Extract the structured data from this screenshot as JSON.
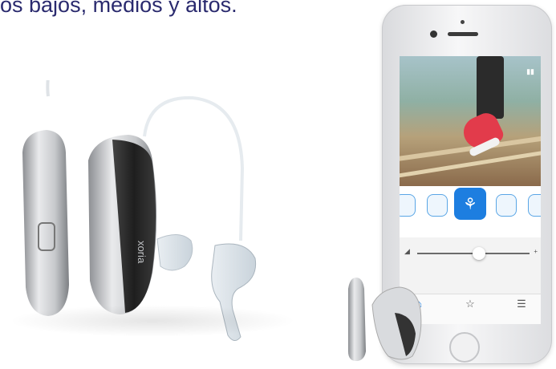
{
  "headline": "os bajos, medios y altos.",
  "hearing_aid": {
    "brand": "xoria"
  },
  "phone_app": {
    "colors": {
      "accent": "#1d7ee0",
      "shoe": "#e23b4b"
    },
    "programs": [
      {
        "icon": "programs-icon"
      },
      {
        "icon": "restaurant-icon"
      },
      {
        "icon": "sport-running-icon",
        "active": true
      },
      {
        "icon": "hand-icon"
      },
      {
        "icon": "music-icon"
      }
    ],
    "volume_level": 0.55,
    "tabs": [
      {
        "icon": "home-icon",
        "active": true
      },
      {
        "icon": "star-icon"
      },
      {
        "icon": "menu-icon"
      }
    ]
  }
}
